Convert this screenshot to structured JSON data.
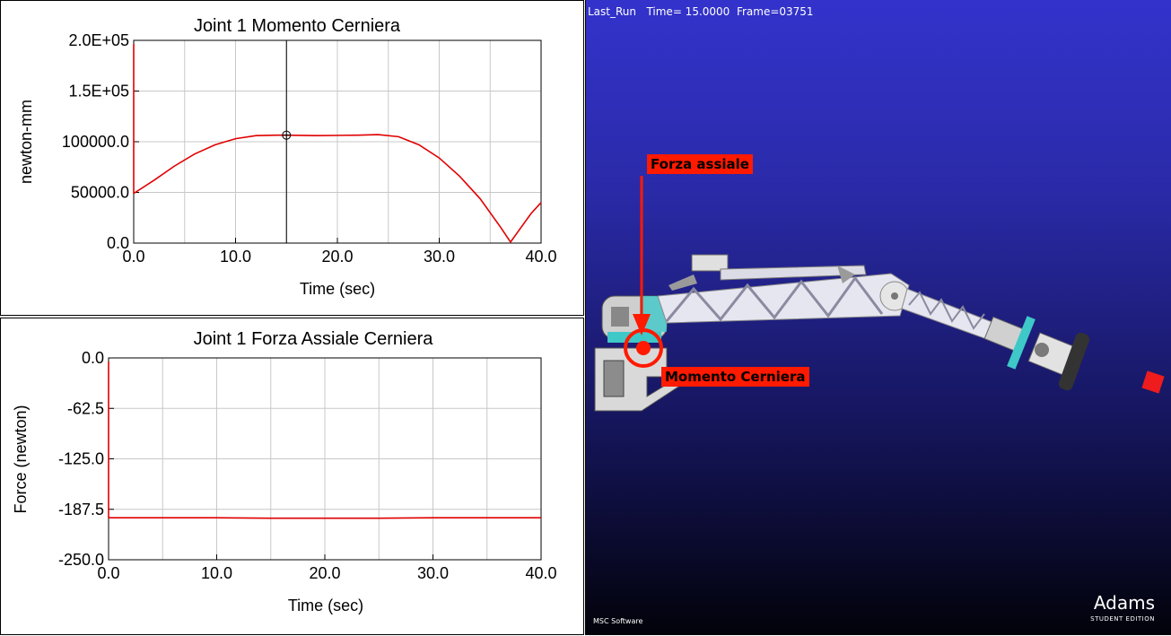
{
  "chart_data": [
    {
      "type": "line",
      "title": "Joint 1 Momento Cerniera",
      "xlabel": "Time (sec)",
      "ylabel": "newton-mm",
      "xlim": [
        0,
        40
      ],
      "ylim": [
        0,
        200000
      ],
      "x_ticks": [
        "0.0",
        "10.0",
        "20.0",
        "30.0",
        "40.0"
      ],
      "y_ticks": [
        "0.0",
        "50000.0",
        "100000.0",
        "1.5E+05",
        "2.0E+05"
      ],
      "grid": true,
      "series_color": "#e00000",
      "cursor_x": 15,
      "series": [
        {
          "x": [
            0,
            2,
            4,
            6,
            8,
            10,
            12,
            14,
            15,
            18,
            22,
            24,
            26,
            28,
            30,
            32,
            34,
            36,
            37,
            38,
            39,
            40
          ],
          "values": [
            49000,
            62000,
            76000,
            88000,
            97000,
            103000,
            106000,
            106500,
            106500,
            106000,
            106500,
            107000,
            105000,
            97000,
            84000,
            66000,
            44000,
            16000,
            1000,
            15000,
            29000,
            40000
          ]
        }
      ]
    },
    {
      "type": "line",
      "title": "Joint 1 Forza Assiale Cerniera",
      "xlabel": "Time (sec)",
      "ylabel": "Force (newton)",
      "xlim": [
        0,
        40
      ],
      "ylim": [
        -250,
        0
      ],
      "x_ticks": [
        "0.0",
        "10.0",
        "20.0",
        "30.0",
        "40.0"
      ],
      "y_ticks": [
        "0.0",
        "-62.5",
        "-125.0",
        "-187.5",
        "-250.0"
      ],
      "grid": true,
      "series_color": "#e00000",
      "series": [
        {
          "x": [
            0,
            5,
            10,
            15,
            20,
            25,
            30,
            35,
            40
          ],
          "values": [
            -198,
            -198,
            -198,
            -198.5,
            -198.5,
            -198.5,
            -198,
            -198,
            -198
          ]
        }
      ]
    }
  ],
  "viewport": {
    "status_text": "Last_Run   Time= 15.0000  Frame=03751",
    "callout_axial": "Forza assiale",
    "callout_moment": "Momento Cerniera",
    "callout_color": "#ff1a00",
    "logo_msc": "MSC Software",
    "logo_adams": "Adams",
    "logo_edition": "STUDENT EDITION"
  }
}
